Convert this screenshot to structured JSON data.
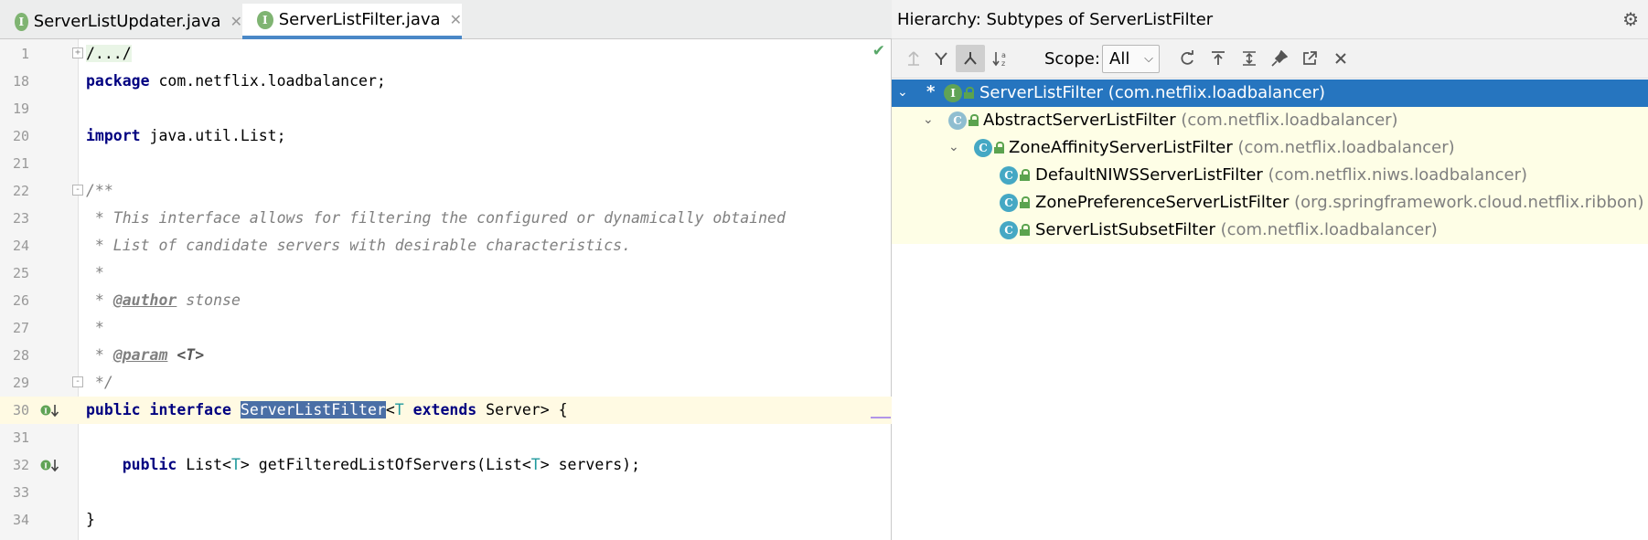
{
  "editor": {
    "tabs": [
      {
        "label": "ServerListUpdater.java",
        "icon": "interface-icon",
        "active": false
      },
      {
        "label": "ServerListFilter.java",
        "icon": "interface-icon",
        "active": true
      }
    ],
    "line_numbers": [
      "1",
      "18",
      "19",
      "20",
      "21",
      "22",
      "23",
      "24",
      "25",
      "26",
      "27",
      "28",
      "29",
      "30",
      "31",
      "32",
      "33",
      "34"
    ],
    "code": {
      "l1": "/.../",
      "l18_kw": "package",
      "l18_rest": " com.netflix.loadbalancer;",
      "l20_kw": "import",
      "l20_rest": " java.util.List;",
      "l22": "/**",
      "l23": " * This interface allows for filtering the configured or dynamically obtained",
      "l24": " * List of candidate servers with desirable characteristics.",
      "l25": " *",
      "l26_star": " * ",
      "l26_tag": "@author",
      "l26_rest": " stonse",
      "l27": " *",
      "l28_star": " * ",
      "l28_tag": "@param",
      "l28_rest": " <T>",
      "l29": " */",
      "l30_kw1": "public",
      "l30_kw2": "interface",
      "l30_name": "ServerListFilter",
      "l30_lt": "<",
      "l30_T": "T",
      "l30_kw3": "extends",
      "l30_rest": " Server> {",
      "l32_kw": "public",
      "l32_a": " List<",
      "l32_T1": "T",
      "l32_b": "> getFilteredListOfServers(List<",
      "l32_T2": "T",
      "l32_c": "> servers);",
      "l34": "}"
    }
  },
  "hierarchy": {
    "title": "Hierarchy:  Subtypes of ServerListFilter",
    "scope_label": "Scope:",
    "scope_value": "All",
    "toolbar_icons": [
      "supertypes-icon",
      "subtypes-hierarchy-icon",
      "subtypes-icon",
      "sort-alpha-icon",
      "refresh-icon",
      "export-icon",
      "expand-all-icon",
      "pin-icon",
      "open-external-icon",
      "close-icon"
    ],
    "tree": [
      {
        "name": "ServerListFilter",
        "pkg": " (com.netflix.loadbalancer)",
        "kind": "I",
        "selected": true
      },
      {
        "name": "AbstractServerListFilter",
        "pkg": " (com.netflix.loadbalancer)",
        "kind": "C",
        "selected": false
      },
      {
        "name": "ZoneAffinityServerListFilter",
        "pkg": " (com.netflix.loadbalancer)",
        "kind": "C",
        "selected": false
      },
      {
        "name": "DefaultNIWSServerListFilter",
        "pkg": " (com.netflix.niws.loadbalancer)",
        "kind": "C",
        "selected": false
      },
      {
        "name": "ZonePreferenceServerListFilter",
        "pkg": " (org.springframework.cloud.netflix.ribbon)",
        "kind": "C",
        "selected": false
      },
      {
        "name": "ServerListSubsetFilter",
        "pkg": " (com.netflix.loadbalancer)",
        "kind": "C",
        "selected": false
      }
    ],
    "selected_marker": "*"
  }
}
